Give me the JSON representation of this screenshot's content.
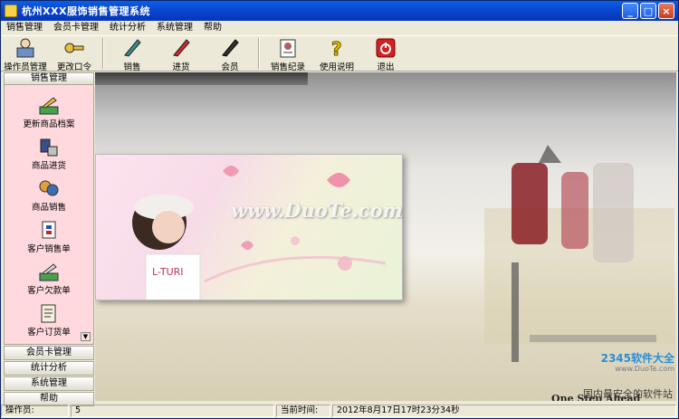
{
  "titlebar": {
    "title": "杭州XXX服饰销售管理系统",
    "min": "_",
    "max": "□",
    "close": "×"
  },
  "menu": [
    "销售管理",
    "会员卡管理",
    "统计分析",
    "系统管理",
    "帮助"
  ],
  "toolbar": [
    {
      "label": "操作员管理",
      "icon": "operator-icon"
    },
    {
      "label": "更改口令",
      "icon": "key-icon"
    },
    {
      "label": "销售",
      "icon": "pen-icon"
    },
    {
      "label": "进货",
      "icon": "red-pen-icon"
    },
    {
      "label": "会员",
      "icon": "black-pen-icon"
    },
    {
      "label": "销售纪录",
      "icon": "record-icon"
    },
    {
      "label": "使用说明",
      "icon": "help-icon"
    },
    {
      "label": "退出",
      "icon": "power-icon"
    }
  ],
  "sidebar": {
    "header": "销售管理",
    "items": [
      {
        "label": "更新商品档案",
        "icon": "update-product-icon"
      },
      {
        "label": "商品进货",
        "icon": "stock-in-icon"
      },
      {
        "label": "商品销售",
        "icon": "sales-icon"
      },
      {
        "label": "客户销售单",
        "icon": "customer-order-icon"
      },
      {
        "label": "客户欠款单",
        "icon": "debt-icon"
      },
      {
        "label": "客户订货单",
        "icon": "order-form-icon"
      }
    ],
    "scroll": "▼",
    "sections": [
      "会员卡管理",
      "统计分析",
      "系统管理",
      "帮助"
    ]
  },
  "main": {
    "watermark": "www.DuoTe.com",
    "slogan": "One Step Ahead",
    "logo_brand": "2345软件大全",
    "logo_site": "www.DuoTe.com",
    "bottom_text": "国内最安全的软件站"
  },
  "status": {
    "operator_label": "操作员:",
    "operator_value": "5",
    "time_label": "当前时间:",
    "time_value": "2012年8月17日17时23分34秒"
  }
}
